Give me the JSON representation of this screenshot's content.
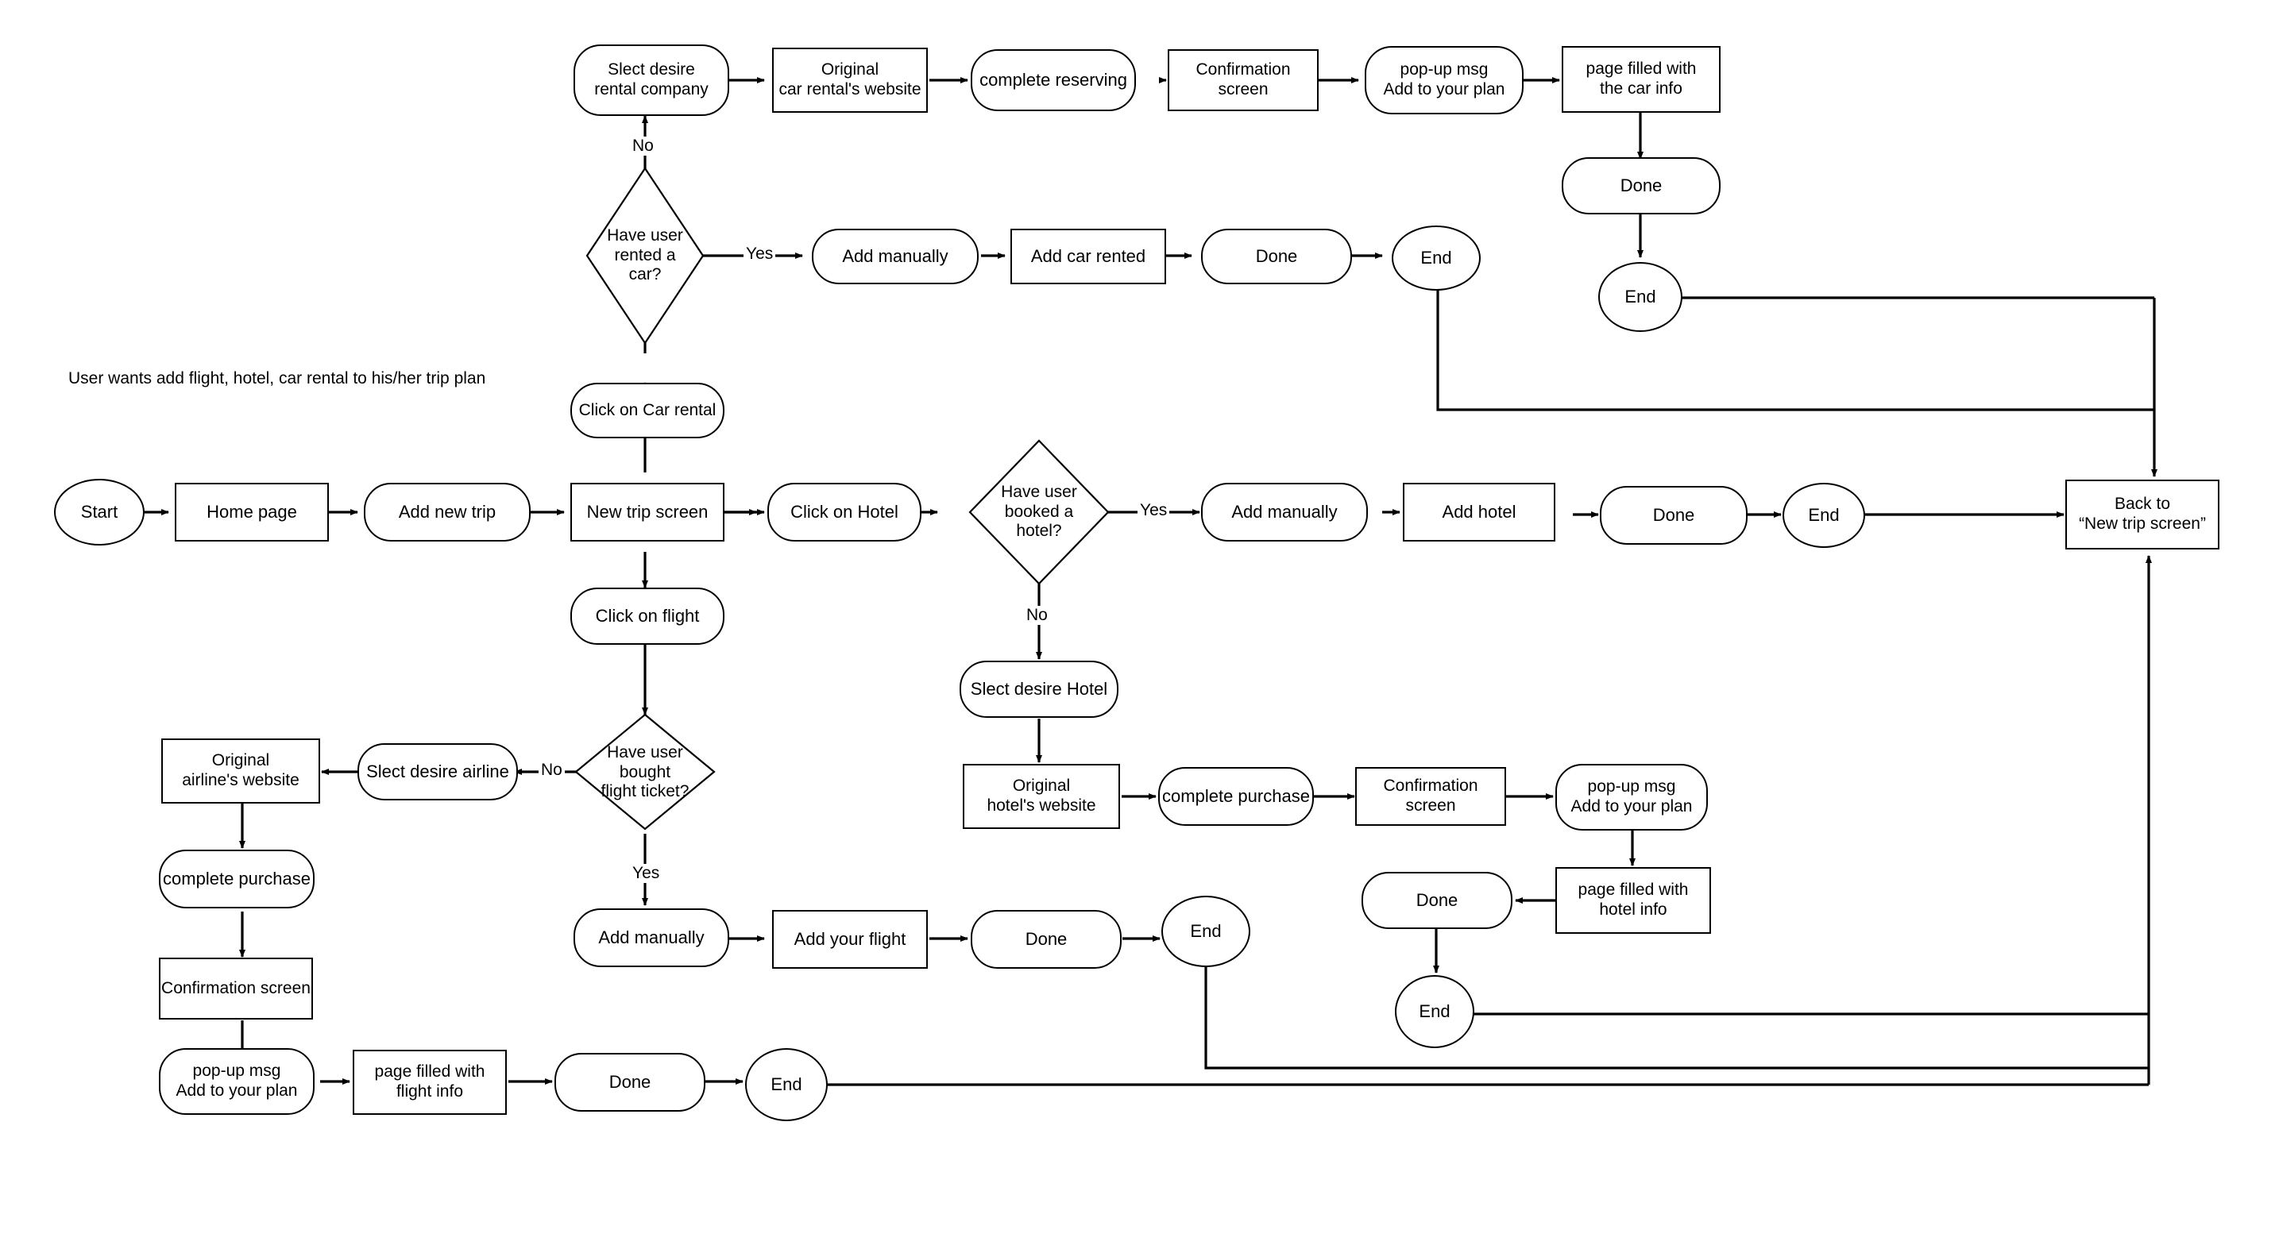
{
  "diagram": {
    "title_note": "User wants add flight, hotel, car rental to his/her trip plan",
    "colors": {
      "stroke": "#000000",
      "fill": "#ffffff",
      "text": "#000000"
    }
  },
  "nodes": {
    "start": "Start",
    "home_page": "Home page",
    "add_new_trip": "Add new trip",
    "new_trip_screen": "New trip screen",
    "click_car_rental": "Click on Car rental",
    "q_car": "Have user\nrented a\ncar?",
    "car_add_manually": "Add manually",
    "add_car_rented": "Add car rented",
    "car_done_manual": "Done",
    "car_end_manual": "End",
    "select_rental_company": "Slect desire\nrental company",
    "car_rental_website": "Original\ncar rental's website",
    "complete_reserving": "complete reserving",
    "car_confirmation": "Confirmation screen",
    "car_popup": "pop-up msg\nAdd to your plan",
    "car_page_filled": "page filled with\nthe car info",
    "car_done_auto": "Done",
    "car_end_auto": "End",
    "click_hotel": "Click on Hotel",
    "q_hotel": "Have user\nbooked a\nhotel?",
    "hotel_add_manually": "Add manually",
    "add_hotel": "Add hotel",
    "hotel_done_manual": "Done",
    "hotel_end_manual": "End",
    "select_hotel": "Slect desire Hotel",
    "hotel_website": "Original\nhotel's website",
    "hotel_complete_purchase": "complete purchase",
    "hotel_confirmation": "Confirmation screen",
    "hotel_popup": "pop-up msg\nAdd to your plan",
    "hotel_page_filled": "page filled with\nhotel info",
    "hotel_done_auto": "Done",
    "hotel_end_auto": "End",
    "click_flight": "Click on flight",
    "q_flight": "Have user\nbought\nflight ticket?",
    "select_airline": "Slect desire airline",
    "airline_website": "Original\nairline's website",
    "flight_complete_purchase": "complete purchase",
    "flight_confirmation": "Confirmation screen",
    "flight_popup": "pop-up msg\nAdd to your plan",
    "flight_page_filled": "page filled with\nflight info",
    "flight_done_auto": "Done",
    "flight_end_auto": "End",
    "flight_add_manually": "Add manually",
    "add_your_flight": "Add your flight",
    "flight_done_manual": "Done",
    "flight_end_manual": "End",
    "back_to_new_trip": "Back to\n“New trip screen”"
  },
  "edge_labels": {
    "car_no": "No",
    "car_yes": "Yes",
    "hotel_yes": "Yes",
    "hotel_no": "No",
    "flight_no": "No",
    "flight_yes": "Yes"
  }
}
